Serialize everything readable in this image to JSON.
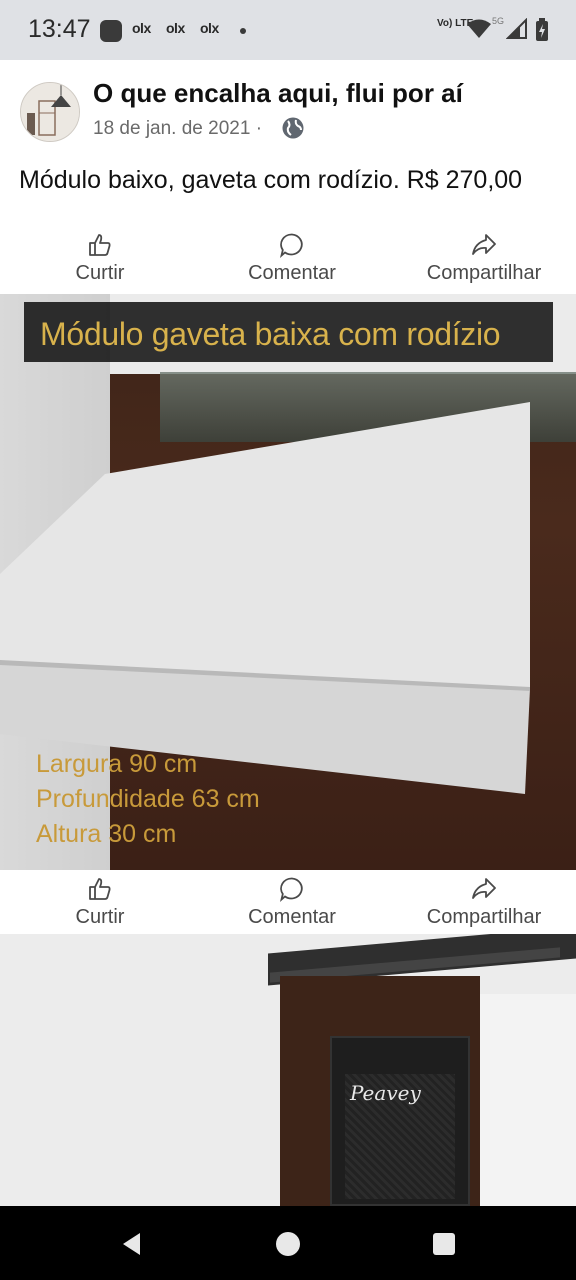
{
  "status_bar": {
    "time": "13:47",
    "notifications": [
      "olx",
      "olx",
      "olx"
    ],
    "network": "Vo) LTE",
    "network_5g": "5G"
  },
  "post": {
    "group_name": "O que encalha aqui, flui por aí",
    "date": "18 de jan. de 2021 ·",
    "text": "Módulo baixo, gaveta com rodízio. R$ 270,00"
  },
  "actions": {
    "like": "Curtir",
    "comment": "Comentar",
    "share": "Compartilhar"
  },
  "photo1": {
    "banner": "Módulo gaveta baixa com rodízio",
    "specs": [
      "Largura  90 cm",
      "Profundidade 63 cm",
      "Altura 30 cm"
    ]
  },
  "photo2": {
    "amp_brand": "Peavey"
  },
  "icons": {
    "privacy": "globe-icon",
    "like": "thumbs-up-icon",
    "comment": "comment-bubble-icon",
    "share": "share-arrow-icon",
    "nav_back": "back-triangle-icon",
    "nav_home": "home-circle-icon",
    "nav_recents": "recents-square-icon"
  },
  "colors": {
    "status_bar": "#dfe1e5",
    "spec_text": "#c89a3a",
    "banner_text": "#d8b24c"
  }
}
